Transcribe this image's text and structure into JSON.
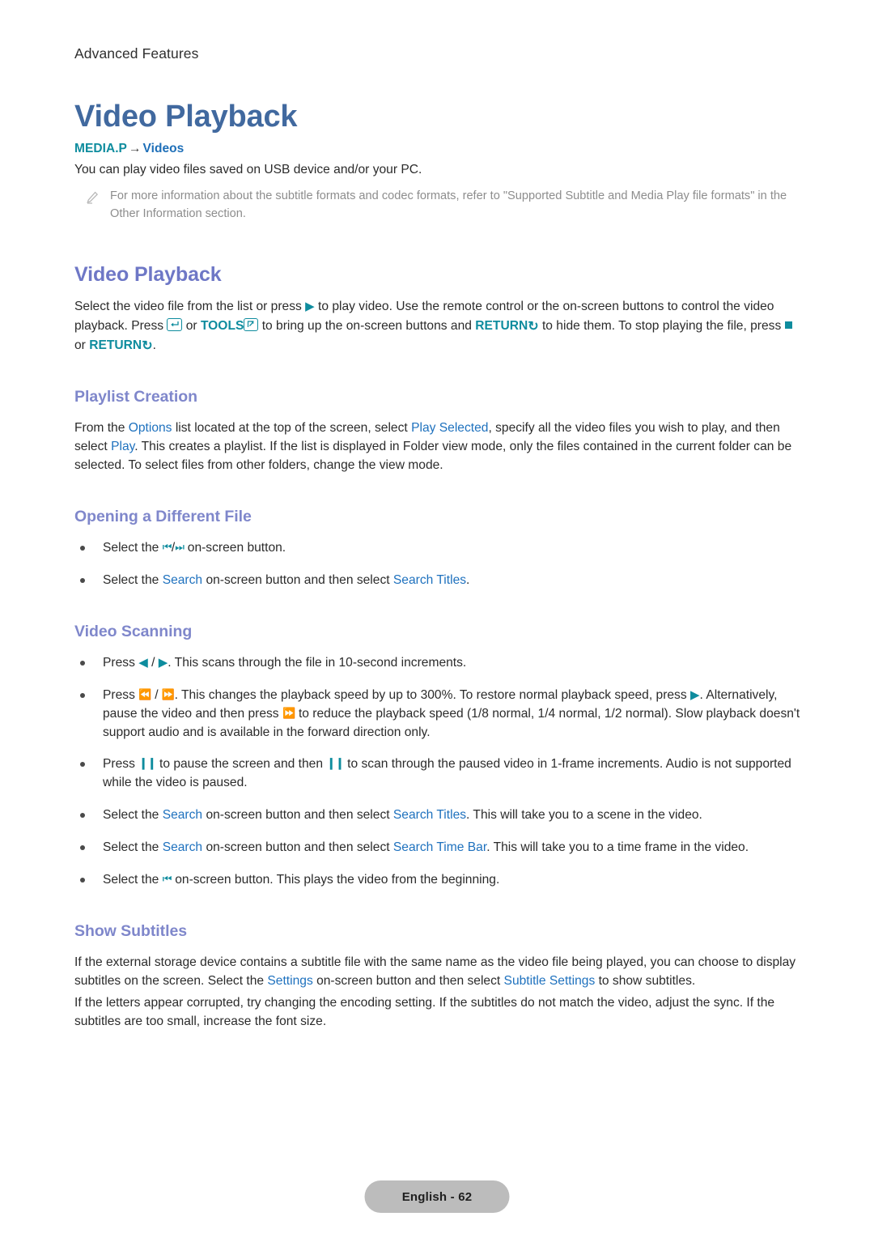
{
  "header": {
    "running_header": "Advanced Features"
  },
  "title": {
    "doc_title": "Video Playback"
  },
  "breadcrumb": {
    "root": "MEDIA.P",
    "arrow": "→",
    "leaf": "Videos"
  },
  "intro": {
    "paragraph": "You can play video files saved on USB device and/or your PC.",
    "note": "For more information about the subtitle formats and codec formats, refer to \"Supported Subtitle and Media Play file formats\" in the Other Information section.",
    "note_icon": "pencil-icon"
  },
  "sections": [
    {
      "id": "video-playback",
      "heading": "Video Playback",
      "paragraph_parts": {
        "p1": "Select the video file from the list or press ",
        "icon_play": "play-icon",
        "p2": " to play video. Use the remote control or the on-screen buttons to control the video playback. Press ",
        "icon_enter": "enter-key-icon",
        "p3": " or ",
        "tools_label": "TOOLS",
        "icon_tools": "tools-key-icon",
        "p4": " to bring up the on-screen buttons and ",
        "return_label_1": "RETURN",
        "icon_return_1": "return-arrow-icon",
        "p5": " to hide them. To stop playing the file, press ",
        "icon_stop": "stop-icon",
        "p6": " or ",
        "return_label_2": "RETURN",
        "icon_return_2": "return-arrow-icon",
        "p7": "."
      }
    },
    {
      "id": "playlist-creation",
      "heading": "Playlist Creation",
      "paragraph_parts": {
        "p1": "From the ",
        "link_options": "Options",
        "p2": " list located at the top of the screen, select ",
        "link_play_selected": "Play Selected",
        "p3": ", specify all the video files you wish to play, and then select ",
        "link_play": "Play",
        "p4": ". This creates a playlist. If the list is displayed in Folder view mode, only the files contained in the current folder can be selected. To select files from other folders, change the view mode."
      }
    },
    {
      "id": "opening-a-different-file",
      "heading": "Opening a Different File",
      "bullets": [
        {
          "p1": "Select the ",
          "icon_prev": "skip-back-icon",
          "sep": "/",
          "icon_next": "skip-forward-icon",
          "p2": " on-screen button."
        },
        {
          "p1": "Select the ",
          "link_1": "Search",
          "p2": " on-screen button and then select ",
          "link_2": "Search Titles",
          "p3": "."
        }
      ]
    },
    {
      "id": "video-scanning",
      "heading": "Video Scanning",
      "bullets": [
        {
          "p1": "Press ",
          "icon_left": "triangle-left-icon",
          "sep": " / ",
          "icon_right": "triangle-right-icon",
          "p2": ". This scans through the file in 10-second increments."
        },
        {
          "p1": "Press ",
          "icon_rewind": "rewind-icon",
          "sep": " / ",
          "icon_ff": "fast-forward-icon",
          "p2": ". This changes the playback speed by up to 300%. To restore normal playback speed, press ",
          "icon_play": "play-icon",
          "p3": ". Alternatively, pause the video and then press ",
          "icon_ff_2": "fast-forward-icon",
          "p4": " to reduce the playback speed (1/8 normal, 1/4 normal, 1/2 normal). Slow playback doesn't support audio and is available in the forward direction only."
        },
        {
          "p1": "Press ",
          "icon_pause_1": "pause-icon",
          "p2": " to pause the screen and then ",
          "icon_pause_2": "pause-icon",
          "p3": " to scan through the paused video in 1-frame increments. Audio is not supported while the video is paused."
        },
        {
          "p1": "Select the ",
          "link_1": "Search",
          "p2": " on-screen button and then select ",
          "link_2": "Search Titles",
          "p3": ". This will take you to a scene in the video."
        },
        {
          "p1": "Select the ",
          "link_1": "Search",
          "p2": " on-screen button and then select ",
          "link_2": "Search Time Bar",
          "p3": ". This will take you to a time frame in the video."
        },
        {
          "p1": "Select the ",
          "icon_prev": "skip-back-icon",
          "p2": " on-screen button. This plays the video from the beginning."
        }
      ]
    },
    {
      "id": "show-subtitles",
      "heading": "Show Subtitles",
      "paragraph_1": {
        "p1": "If the external storage device contains a subtitle file with the same name as the video file being played, you can choose to display subtitles on the screen. Select the ",
        "link_1": "Settings",
        "p2": " on-screen button and then select ",
        "link_2": "Subtitle Settings",
        "p3": " to show subtitles."
      },
      "paragraph_2": "If the letters appear corrupted, try changing the encoding setting. If the subtitles do not match the video, adjust the sync. If the subtitles are too small, increase the font size."
    }
  ],
  "footer": {
    "page_label": "English - 62"
  },
  "colors": {
    "doc_title": "#41699F",
    "section_heading": "#6E77C6",
    "sub_heading": "#7F87CB",
    "link": "#1E71BE",
    "teal": "#0E8C9E",
    "note_text": "#8d8d8d",
    "footer_pill": "#bcbcbc"
  }
}
